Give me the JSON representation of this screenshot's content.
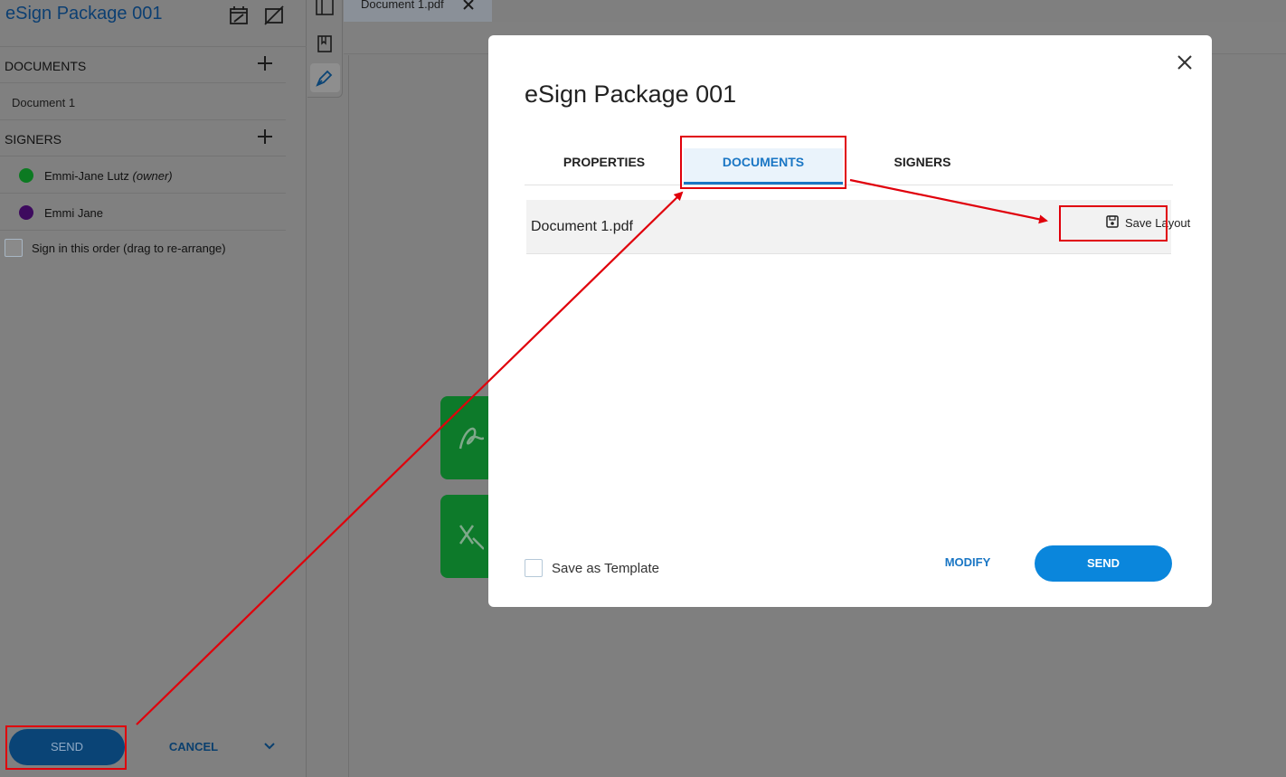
{
  "sidebar": {
    "title": "eSign Package 001",
    "documents_header": "DOCUMENTS",
    "documents": [
      "Document 1"
    ],
    "signers_header": "SIGNERS",
    "signers": [
      {
        "name": "Emmi-Jane Lutz",
        "role": "(owner)",
        "color": "#0c7a22"
      },
      {
        "name": "Emmi Jane",
        "role": "",
        "color": "#3d0a5e"
      }
    ],
    "sign_order_label": "Sign in this order (drag to re-arrange)",
    "send_label": "SEND",
    "cancel_label": "CANCEL"
  },
  "document_tab": {
    "name": "Document 1.pdf"
  },
  "modal": {
    "title": "eSign Package 001",
    "tabs": [
      {
        "label": "PROPERTIES",
        "active": false
      },
      {
        "label": "DOCUMENTS",
        "active": true
      },
      {
        "label": "SIGNERS",
        "active": false
      }
    ],
    "documents": [
      {
        "file": "Document 1.pdf",
        "action": "Save Layout"
      }
    ],
    "save_template_label": "Save as Template",
    "modify_label": "MODIFY",
    "send_label": "SEND"
  },
  "colors": {
    "accent": "#0a86dc",
    "annotation": "#e0000b",
    "active_tab": "#1a76c4"
  }
}
